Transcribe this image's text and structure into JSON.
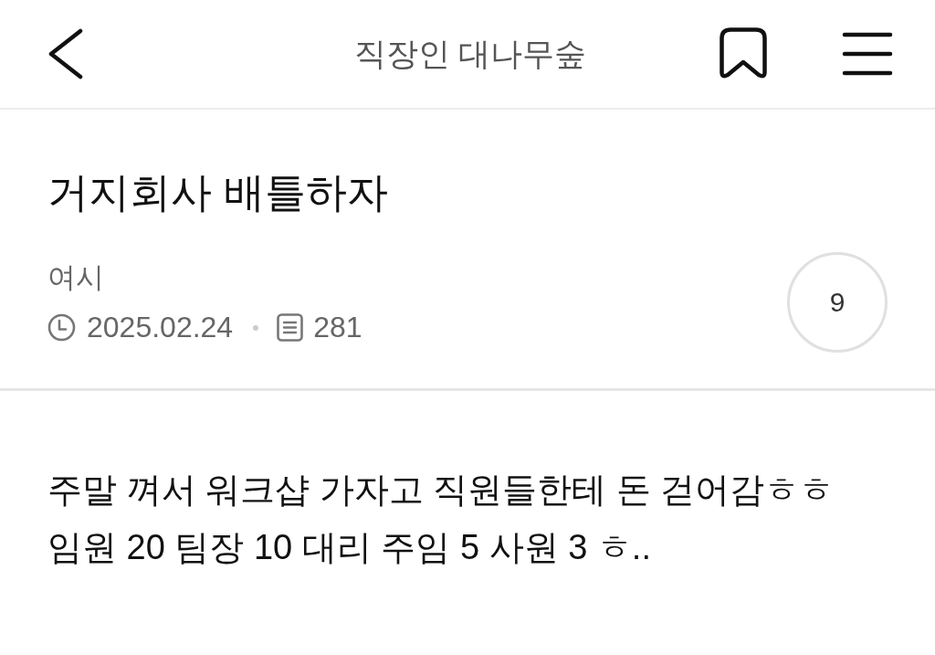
{
  "header": {
    "title": "직장인 대나무숲"
  },
  "post": {
    "title": "거지회사 배틀하자",
    "author": "여시",
    "date": "2025.02.24",
    "view_count": "281",
    "comment_count": "9"
  },
  "body": {
    "lines": [
      "주말 껴서 워크샵 가자고 직원들한테 돈 걷어감ㅎㅎ",
      "임원 20 팀장 10 대리 주임 5 사원 3 ㅎ.."
    ]
  }
}
